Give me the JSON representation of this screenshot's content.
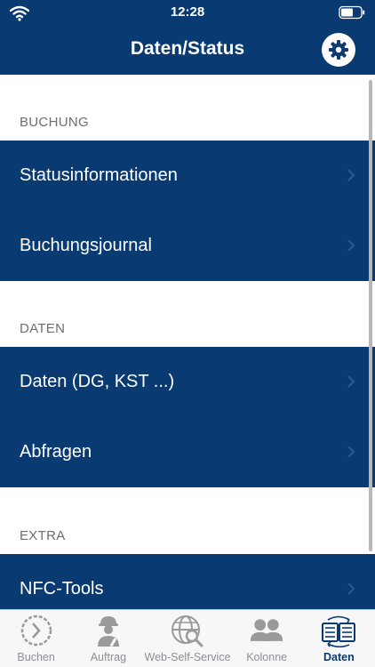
{
  "status_bar": {
    "time": "12:28"
  },
  "nav_bar": {
    "title": "Daten/Status"
  },
  "sections": [
    {
      "header": "BUCHUNG",
      "items": [
        "Statusinformationen",
        "Buchungsjournal"
      ]
    },
    {
      "header": "DATEN",
      "items": [
        "Daten (DG, KST ...)",
        "Abfragen"
      ]
    },
    {
      "header": "EXTRA",
      "items": [
        "NFC-Tools"
      ]
    }
  ],
  "tab_bar": {
    "items": [
      {
        "label": "Buchen",
        "icon": "clock-icon"
      },
      {
        "label": "Auftrag",
        "icon": "worker-icon"
      },
      {
        "label": "Web-Self-Service",
        "icon": "web-search-icon"
      },
      {
        "label": "Kolonne",
        "icon": "people-icon"
      },
      {
        "label": "Daten",
        "icon": "data-book-icon"
      }
    ],
    "active": "Daten"
  },
  "colors": {
    "primary": "#0a3a72",
    "section_header_text": "#6d6d72",
    "tab_inactive": "#8e8e93"
  }
}
